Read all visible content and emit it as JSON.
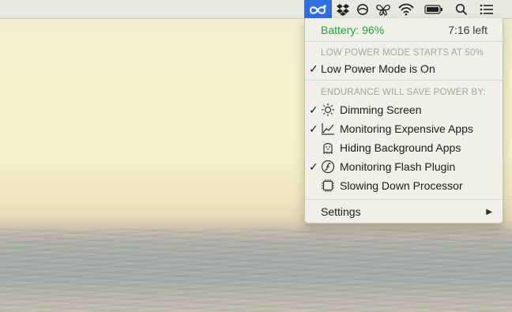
{
  "menubar": {
    "icons": [
      "endurance-icon",
      "dropbox-icon",
      "status-circle-icon",
      "butterfly-icon",
      "wifi-icon",
      "battery-icon",
      "search-icon",
      "list-icon"
    ]
  },
  "menu": {
    "battery_label": "Battery: 96%",
    "time_left": "7:16 left",
    "low_power_header": "LOW POWER MODE STARTS AT 50%",
    "low_power_status": "Low Power Mode is On",
    "low_power_checked": true,
    "endurance_header": "ENDURANCE WILL SAVE POWER BY:",
    "items": [
      {
        "label": "Dimming Screen",
        "checked": true,
        "icon": "brightness-icon"
      },
      {
        "label": "Monitoring Expensive Apps",
        "checked": true,
        "icon": "chart-icon"
      },
      {
        "label": "Hiding Background Apps",
        "checked": false,
        "icon": "ghost-icon"
      },
      {
        "label": "Monitoring Flash Plugin",
        "checked": true,
        "icon": "flash-icon"
      },
      {
        "label": "Slowing Down Processor",
        "checked": false,
        "icon": "processor-icon"
      }
    ],
    "settings_label": "Settings",
    "checkmark": "✓",
    "submenu_arrow": "▶"
  },
  "colors": {
    "accent": "#2f6fe0",
    "battery_green": "#1fa33a"
  }
}
